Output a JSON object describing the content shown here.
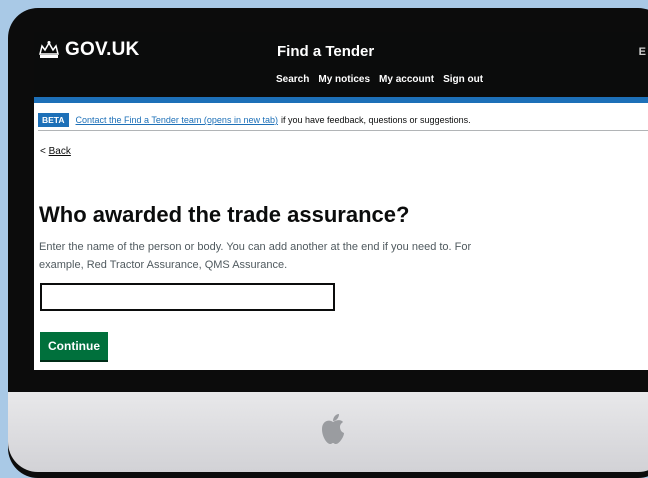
{
  "header": {
    "logo_text": "GOV.UK",
    "service_name": "Find a Tender",
    "nav": [
      "Search",
      "My notices",
      "My account",
      "Sign out"
    ],
    "language_toggle": "E"
  },
  "phase_banner": {
    "tag": "BETA",
    "link_text": "Contact the Find a Tender team (opens in new tab)",
    "text": "if you have feedback, questions or suggestions."
  },
  "back_link": {
    "arrow": "<",
    "label": "Back"
  },
  "question": {
    "heading": "Who awarded the trade assurance?",
    "hint": "Enter the name of the person or body. You can add another at the end if you need to. For example, Red Tractor Assurance, QMS Assurance.",
    "input_value": ""
  },
  "continue_button": "Continue",
  "colors": {
    "header_bg": "#0b0c0c",
    "accent_blue": "#1d70b8",
    "button_green": "#00703c",
    "background": "#a9c9e6"
  }
}
